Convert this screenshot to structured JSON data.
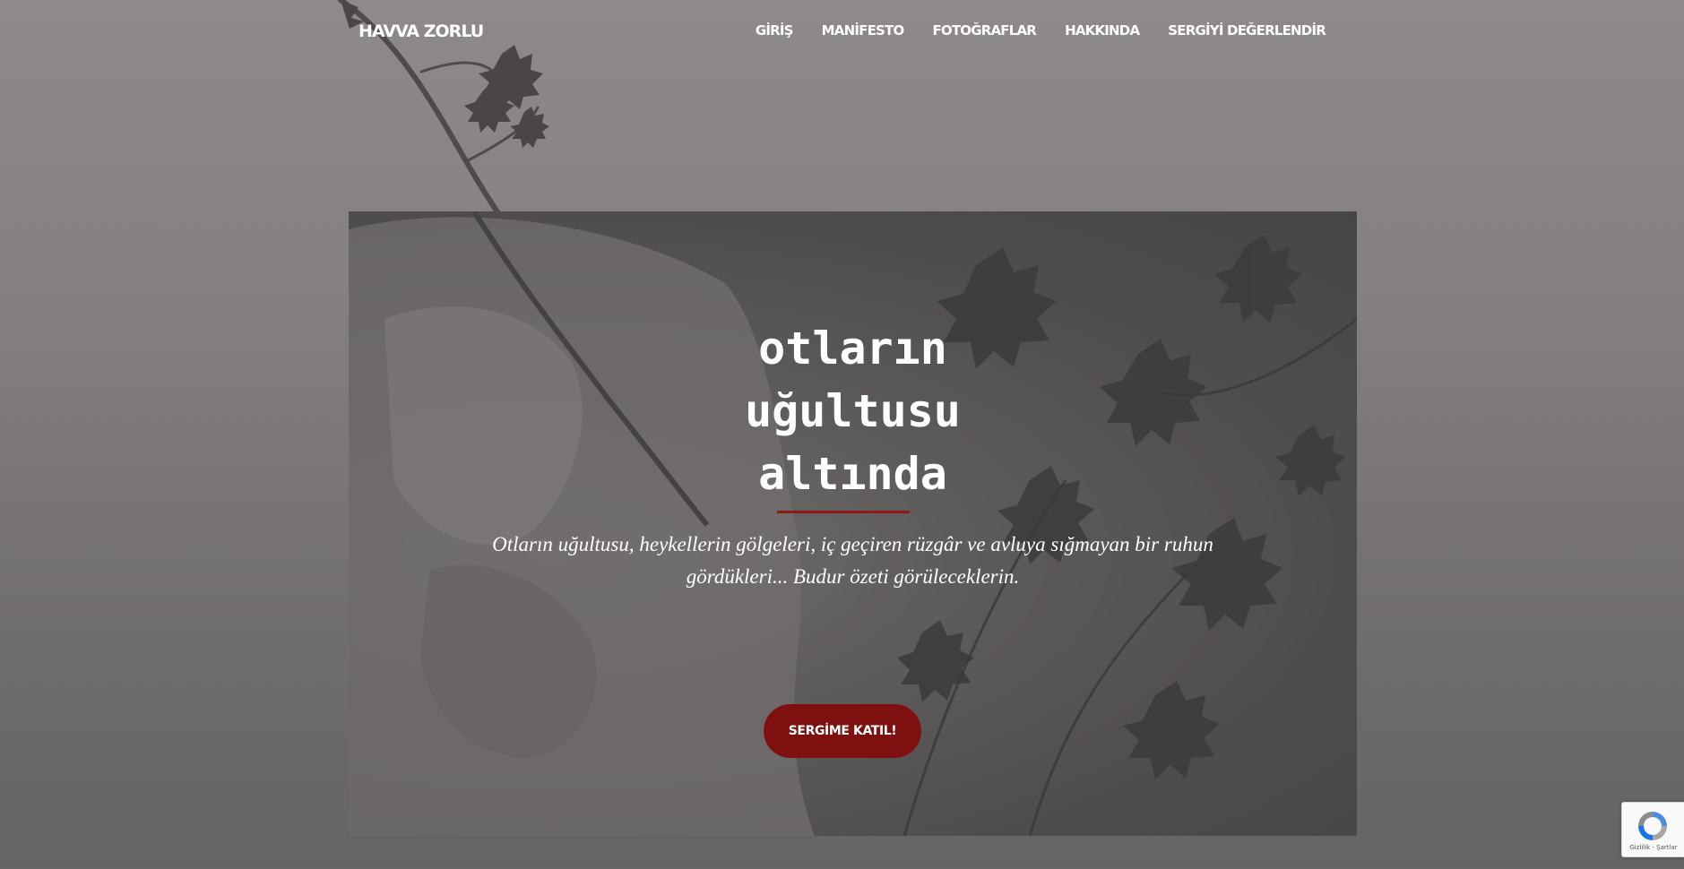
{
  "header": {
    "brand": "HAVVA ZORLU",
    "nav": [
      "GİRİŞ",
      "MANİFESTO",
      "FOTOĞRAFLAR",
      "HAKKINDA",
      "SERGİYİ DEĞERLENDİR"
    ]
  },
  "hero": {
    "title": "otların\nuğultusu\naltında",
    "subtitle": "Otların uğultusu, heykellerin gölgeleri, iç geçiren rüzgâr ve avluya sığmayan bir ruhun gördükleri... Budur özeti görüleceklerin.",
    "cta_label": "SERGİME KATIL!",
    "accent_color": "#7f1010"
  },
  "recaptcha": {
    "legal": "Gizlilik - Şartlar",
    "icon": "recaptcha-logo-icon"
  }
}
